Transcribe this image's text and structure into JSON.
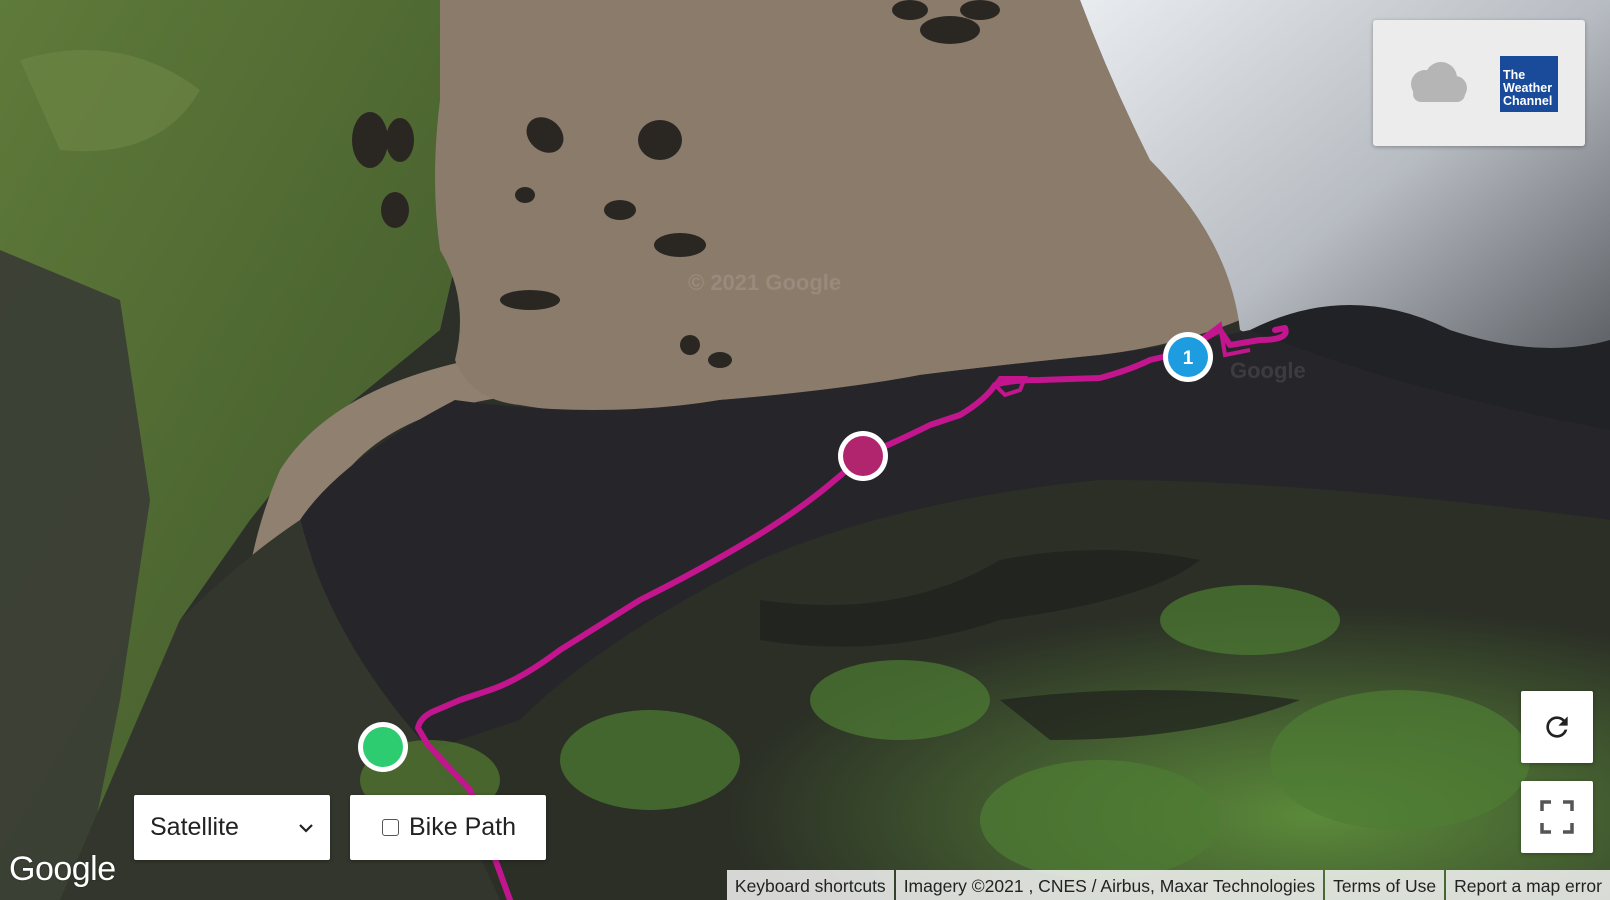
{
  "map": {
    "watermark": "© 2021 Google",
    "watermark_right": "Google",
    "route_color": "#c2158e",
    "markers": {
      "start": {
        "color": "#2ecc71"
      },
      "midpoint": {
        "color": "#b0256e"
      },
      "waypoint": {
        "color": "#1e9ce0",
        "label": "1"
      }
    }
  },
  "weather_widget": {
    "icon": "cloud-icon",
    "brand_lines": [
      "The",
      "Weather",
      "Channel"
    ]
  },
  "controls": {
    "map_type": {
      "selected": "Satellite"
    },
    "bike_path": {
      "label": "Bike Path",
      "checked": false
    },
    "reload_icon": "reload-icon",
    "fullscreen_icon": "fullscreen-icon"
  },
  "footer": {
    "logo": "Google",
    "keyboard_shortcuts": "Keyboard shortcuts",
    "imagery": "Imagery ©2021 , CNES / Airbus, Maxar Technologies",
    "terms": "Terms of Use",
    "report": "Report a map error"
  }
}
